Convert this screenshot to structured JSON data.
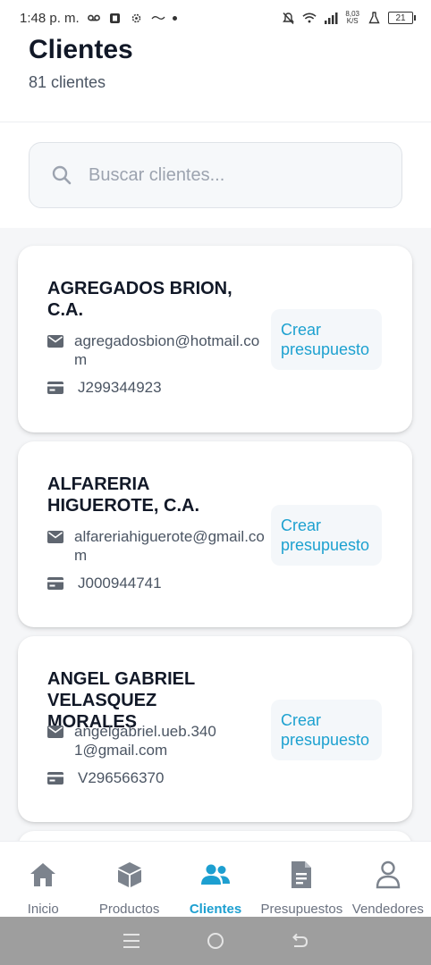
{
  "status_bar": {
    "time": "1:48 p. m.",
    "net_speed_value": "8,03",
    "net_speed_unit": "K/S",
    "battery": "21"
  },
  "header": {
    "title": "Clientes",
    "subtitle": "81 clientes"
  },
  "search": {
    "placeholder": "Buscar clientes...",
    "value": ""
  },
  "clients": [
    {
      "name": "AGREGADOS BRION, C.A.",
      "email": "agregadosbion@hotmail.com",
      "id": "J299344923",
      "action": "Crear presupuesto"
    },
    {
      "name": "ALFARERIA HIGUEROTE, C.A.",
      "email": "alfareriahiguerote@gmail.com",
      "id": "J000944741",
      "action": "Crear presupuesto"
    },
    {
      "name": "ANGEL GABRIEL VELASQUEZ MORALES",
      "email": "angelgabriel.ueb.3401@gmail.com",
      "id": "V296566370",
      "action": "Crear presupuesto"
    }
  ],
  "bottom_nav": [
    {
      "label": "Inicio",
      "icon": "home-icon",
      "active": false
    },
    {
      "label": "Productos",
      "icon": "box-icon",
      "active": false
    },
    {
      "label": "Clientes",
      "icon": "users-icon",
      "active": true
    },
    {
      "label": "Presupuestos",
      "icon": "document-icon",
      "active": false
    },
    {
      "label": "Vendedores",
      "icon": "user-icon",
      "active": false
    }
  ],
  "colors": {
    "accent": "#1d9fd0",
    "nav_inactive": "#6b7280",
    "title": "#111827"
  }
}
